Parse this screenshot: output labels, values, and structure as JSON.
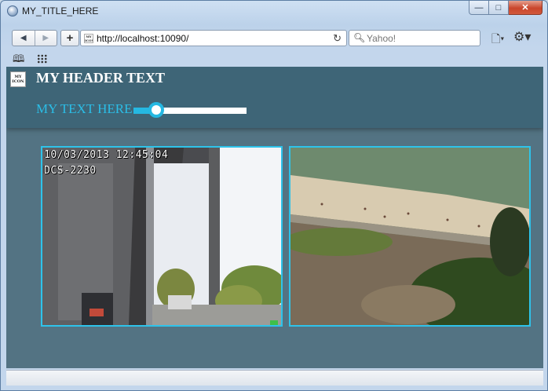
{
  "window": {
    "title": "MY_TITLE_HERE",
    "controls": {
      "minimize": "—",
      "maximize": "□",
      "close": "✕"
    }
  },
  "toolbar": {
    "back_label": "◀",
    "forward_label": "▶",
    "new_tab_label": "+",
    "url": "http://localhost:10090/",
    "site_icon_text": "MY ICON",
    "search_placeholder": "Yahoo!",
    "page_menu_label": "🗋▾",
    "gear_menu_label": "⚙▾",
    "bookmarks_label": "🕮"
  },
  "page": {
    "icon_text": "MY ICON",
    "header_text": "MY HEADER TEXT",
    "text_label": "MY TEXT HERE",
    "slider": {
      "value_percent": 20
    }
  },
  "cameras": [
    {
      "timestamp": "10/03/2013 12:45:04",
      "camera_name": "DCS-2230",
      "scene": "window-interior"
    },
    {
      "scene": "beach-overlook"
    }
  ],
  "colors": {
    "accent": "#2bbde6",
    "header_band": "#3e6577",
    "page_background": "#537383"
  }
}
